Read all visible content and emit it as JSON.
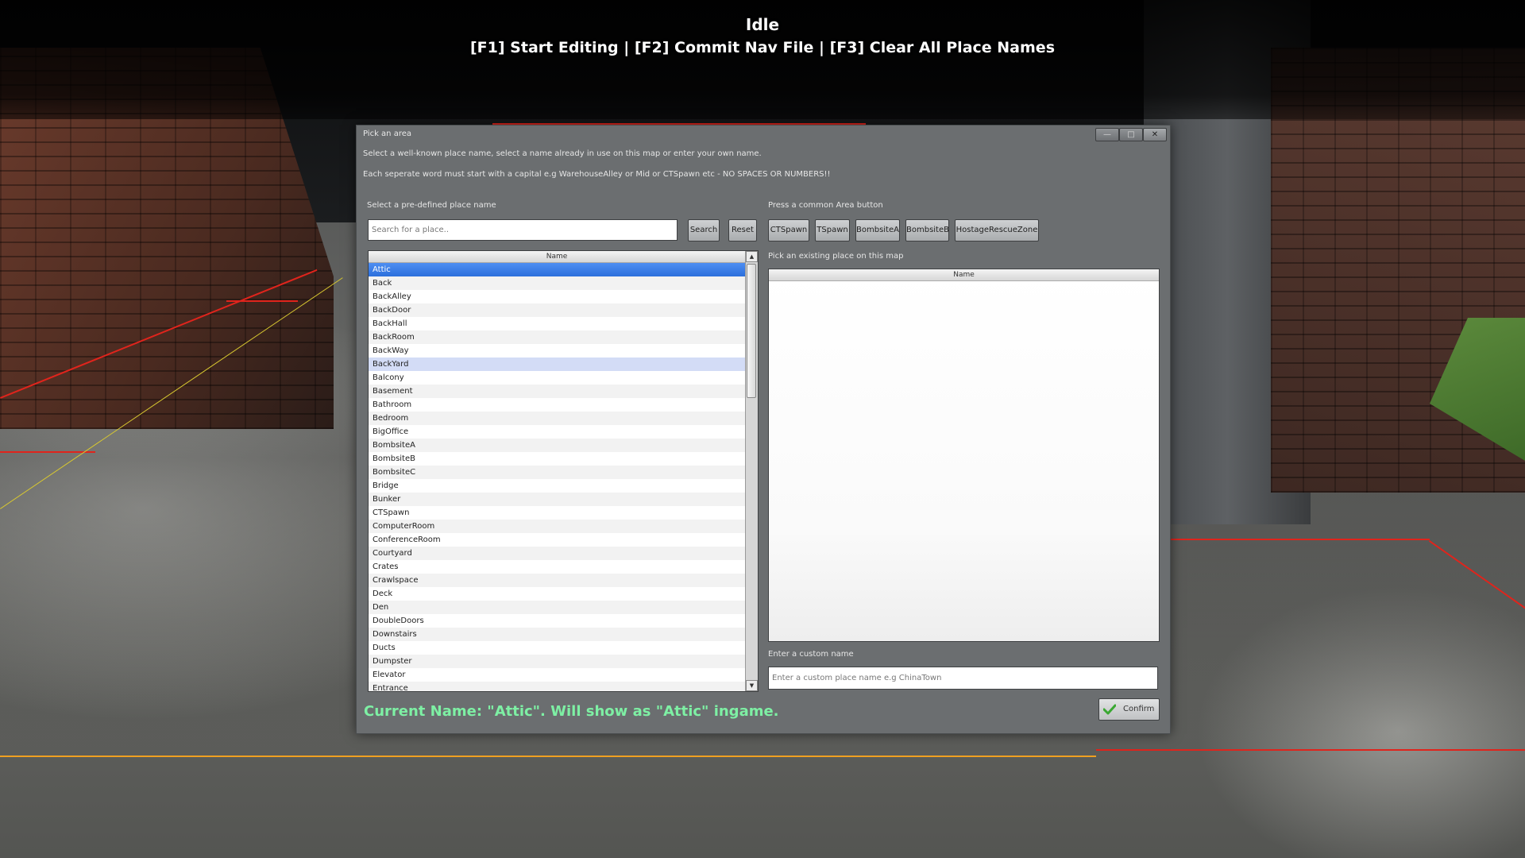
{
  "hud": {
    "mode": "Idle",
    "keys": "[F1] Start Editing | [F2] Commit Nav File | [F3] Clear All Place Names"
  },
  "window": {
    "title": "Pick an area",
    "controls": {
      "minimize": "—",
      "maximize": "□",
      "close": "✕"
    },
    "info_line1": "Select a well-known place name, select a name already in use on this map or enter your own name.",
    "info_line2": "Each seperate word must start with a capital e.g WarehouseAlley or Mid or CTSpawn etc - NO SPACES OR NUMBERS!!"
  },
  "predefined": {
    "label": "Select a pre-defined place name",
    "search_placeholder": "Search for a place..",
    "search_button": "Search",
    "reset_button": "Reset",
    "column": "Name",
    "selected": "Attic",
    "hovered": "BackYard",
    "items": [
      "Attic",
      "Back",
      "BackAlley",
      "BackDoor",
      "BackHall",
      "BackRoom",
      "BackWay",
      "BackYard",
      "Balcony",
      "Basement",
      "Bathroom",
      "Bedroom",
      "BigOffice",
      "BombsiteA",
      "BombsiteB",
      "BombsiteC",
      "Bridge",
      "Bunker",
      "CTSpawn",
      "ComputerRoom",
      "ConferenceRoom",
      "Courtyard",
      "Crates",
      "Crawlspace",
      "Deck",
      "Den",
      "DoubleDoors",
      "Downstairs",
      "Ducts",
      "Dumpster",
      "Elevator",
      "Entrance"
    ]
  },
  "common": {
    "label": "Press a common Area button",
    "buttons": [
      "CTSpawn",
      "TSpawn",
      "BombsiteA",
      "BombsiteB",
      "HostageRescueZone"
    ]
  },
  "existing": {
    "label": "Pick an existing place on this map",
    "column": "Name"
  },
  "custom": {
    "label": "Enter a custom name",
    "placeholder": "Enter a custom place name e.g ChinaTown"
  },
  "status": {
    "current": "Current Name: \"Attic\". Will show as \"Attic\" ingame."
  },
  "confirm": {
    "label": "Confirm",
    "icon": "checkmark-icon",
    "icon_color": "#3aa832"
  },
  "colors": {
    "selection": "#2c6fdc",
    "status_text": "#7ef0a4",
    "nav_line": "#e0241c"
  }
}
